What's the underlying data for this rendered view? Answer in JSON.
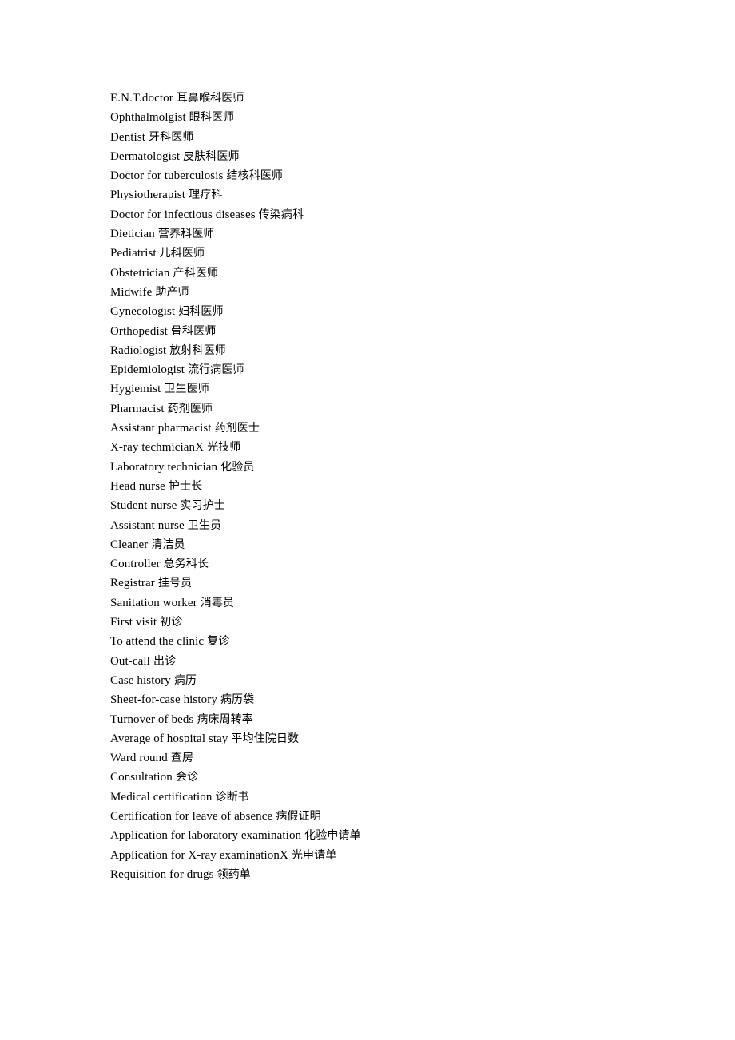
{
  "document": {
    "page_background": "#ffffff",
    "text_color": "#000000",
    "entries": [
      {
        "term": "E.N.T.doctor",
        "gloss": "耳鼻喉科医师",
        "space": true
      },
      {
        "term": "Ophthalmolgist",
        "gloss": "眼科医师",
        "space": true
      },
      {
        "term": "Dentist",
        "gloss": "牙科医师",
        "space": true
      },
      {
        "term": "Dermatologist",
        "gloss": "皮肤科医师",
        "space": true
      },
      {
        "term": "Doctor for tuberculosis",
        "gloss": "结核科医师",
        "space": true
      },
      {
        "term": "Physiotherapist",
        "gloss": "理疗科",
        "space": true
      },
      {
        "term": "Doctor for infectious diseases",
        "gloss": "传染病科",
        "space": true
      },
      {
        "term": "Dietician",
        "gloss": "营养科医师",
        "space": true
      },
      {
        "term": "Pediatrist",
        "gloss": "儿科医师",
        "space": true
      },
      {
        "term": "Obstetrician",
        "gloss": "产科医师",
        "space": true
      },
      {
        "term": "Midwife",
        "gloss": "助产师",
        "space": true
      },
      {
        "term": "Gynecologist",
        "gloss": "妇科医师",
        "space": true
      },
      {
        "term": "Orthopedist",
        "gloss": "骨科医师",
        "space": true
      },
      {
        "term": "Radiologist",
        "gloss": "放射科医师",
        "space": true
      },
      {
        "term": "Epidemiologist",
        "gloss": "流行病医师",
        "space": true
      },
      {
        "term": "Hygiemist",
        "gloss": "卫生医师",
        "space": true
      },
      {
        "term": "Pharmacist",
        "gloss": "药剂医师",
        "space": true
      },
      {
        "term": "Assistant pharmacist",
        "gloss": "药剂医士",
        "space": true
      },
      {
        "term": "X-ray techmicianX",
        "gloss": "光技师",
        "space": true
      },
      {
        "term": "Laboratory technician",
        "gloss": "化验员",
        "space": true
      },
      {
        "term": "Head nurse",
        "gloss": "护士长",
        "space": true
      },
      {
        "term": "Student nurse",
        "gloss": "实习护士",
        "space": true
      },
      {
        "term": "Assistant nurse",
        "gloss": "卫生员",
        "space": true
      },
      {
        "term": "Cleaner",
        "gloss": "清洁员",
        "space": true
      },
      {
        "term": "Controller",
        "gloss": "总务科长",
        "space": true
      },
      {
        "term": "Registrar",
        "gloss": "挂号员",
        "space": true
      },
      {
        "term": "Sanitation worker",
        "gloss": "消毒员",
        "space": true
      },
      {
        "term": "First visit",
        "gloss": "初诊",
        "space": true
      },
      {
        "term": "To attend the clinic",
        "gloss": "复诊",
        "space": true
      },
      {
        "term": "Out-call",
        "gloss": "出诊",
        "space": true
      },
      {
        "term": "Case history",
        "gloss": "病历",
        "space": true
      },
      {
        "term": "Sheet-for-case history",
        "gloss": "病历袋",
        "space": true
      },
      {
        "term": "Turnover of beds",
        "gloss": "病床周转率",
        "space": true
      },
      {
        "term": "Average of hospital stay",
        "gloss": "平均住院日数",
        "space": true
      },
      {
        "term": "Ward round",
        "gloss": "查房",
        "space": true
      },
      {
        "term": "Consultation",
        "gloss": "会诊",
        "space": true
      },
      {
        "term": "Medical certification",
        "gloss": "诊断书",
        "space": true
      },
      {
        "term": "Certification for leave of absence",
        "gloss": "病假证明",
        "space": true
      },
      {
        "term": "Application for laboratory examination",
        "gloss": "化验申请单",
        "space": true
      },
      {
        "term": "Application for X-ray examinationX",
        "gloss": "光申请单",
        "space": true
      },
      {
        "term": "Requisition for drugs",
        "gloss": "领药单",
        "space": true
      }
    ]
  }
}
